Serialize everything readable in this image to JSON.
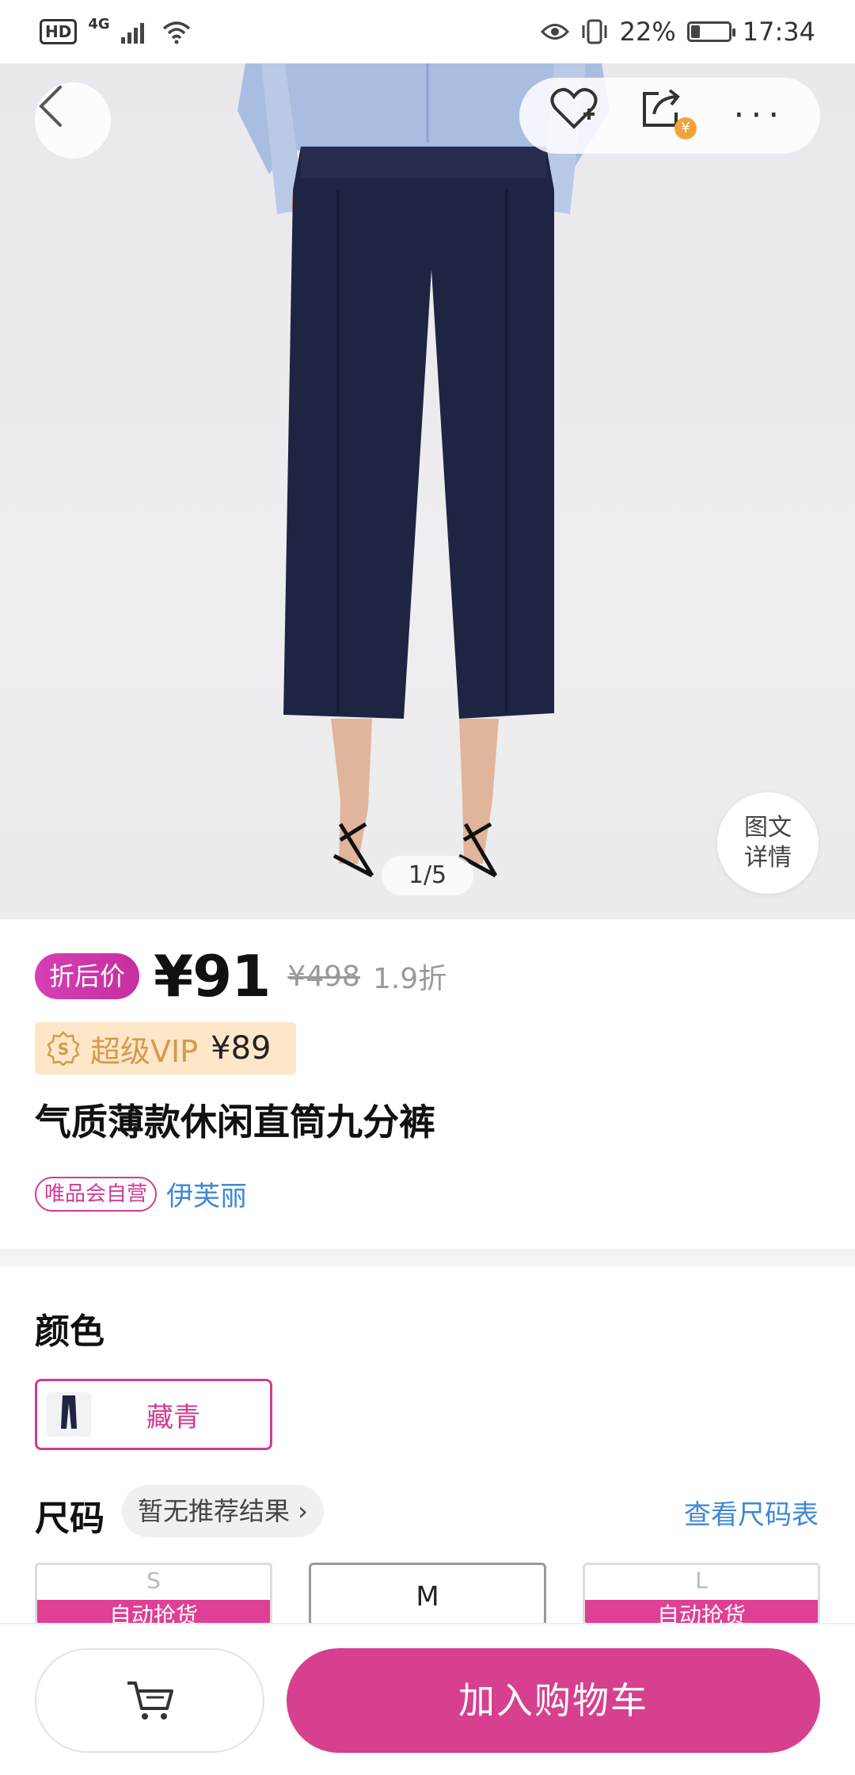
{
  "status_bar": {
    "hd": "HD",
    "network": "4G",
    "battery_percent": "22%",
    "battery_level": 0.22,
    "time": "17:34"
  },
  "gallery": {
    "page_indicator": "1/5",
    "detail_button_line1": "图文",
    "detail_button_line2": "详情",
    "icons": [
      "back-arrow-icon",
      "favorite-heart-plus-icon",
      "share-icon",
      "more-dots-icon"
    ]
  },
  "price": {
    "discount_tag": "折后价",
    "current": "¥91",
    "original": "¥498",
    "discount": "1.9折",
    "vip_label": "超级VIP",
    "vip_price": "¥89"
  },
  "product": {
    "title": "气质薄款休闲直筒九分裤",
    "self_operated_tag": "唯品会自营",
    "brand": "伊芙丽"
  },
  "color": {
    "label": "颜色",
    "selected": "藏青"
  },
  "size": {
    "label": "尺码",
    "recommendation": "暂无推荐结果 ›",
    "chart_link": "查看尺码表",
    "options": [
      {
        "name": "S",
        "note": "自动抢货"
      },
      {
        "name": "M",
        "note": ""
      },
      {
        "name": "L",
        "note": "自动抢货"
      }
    ]
  },
  "bottom_bar": {
    "add_to_cart": "加入购物车"
  },
  "colors": {
    "accent": "#d6408f",
    "link": "#3f87d8",
    "vip_bg": "#fde7c8"
  }
}
